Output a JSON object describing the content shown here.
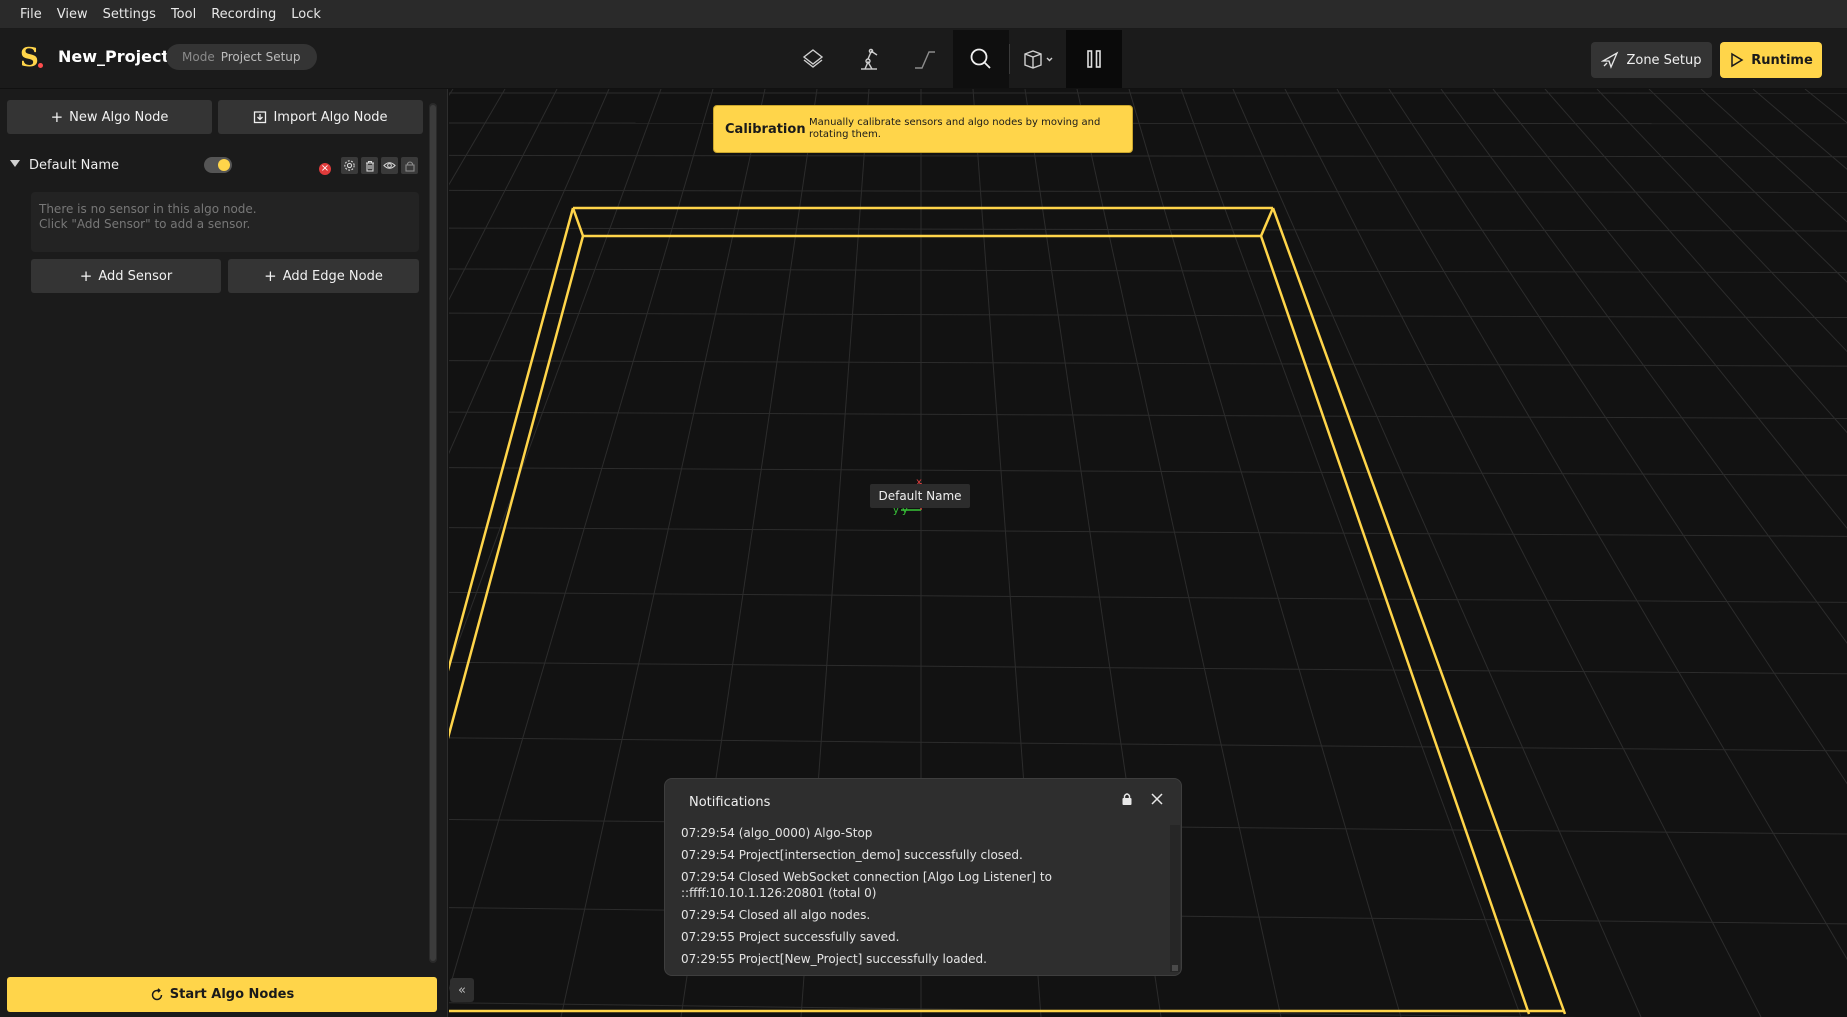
{
  "menu": [
    "File",
    "View",
    "Settings",
    "Tool",
    "Recording",
    "Lock"
  ],
  "header": {
    "logo": "S",
    "project_name": "New_Project",
    "mode_label": "Mode",
    "mode_value": "Project Setup",
    "zone_setup": "Zone Setup",
    "runtime": "Runtime"
  },
  "toolbar_icons": [
    "layers-icon",
    "robot-arm-icon",
    "slope-icon",
    "search-icon",
    "cube-view-icon",
    "pause-icon"
  ],
  "left_panel": {
    "new_algo_node": "New Algo Node",
    "import_algo_node": "Import Algo Node",
    "algo_node_name": "Default Name",
    "empty_line1": "There is no sensor in this algo node.",
    "empty_line2": "Click \"Add Sensor\" to add a sensor.",
    "add_sensor": "Add Sensor",
    "add_edge_node": "Add Edge Node",
    "start_algo_nodes": "Start Algo Nodes"
  },
  "calibration": {
    "title": "Calibration",
    "description": "Manually calibrate sensors and algo nodes by moving and rotating them."
  },
  "viewport": {
    "node_label": "Default Name",
    "axis_x": "x",
    "axis_y": "y"
  },
  "notifications": {
    "title": "Notifications",
    "lines": [
      "07:29:54 (algo_0000) Algo-Stop",
      "07:29:54 Project[intersection_demo] successfully closed.",
      "07:29:54 Closed WebSocket connection [Algo Log Listener] to ::ffff:10.10.1.126:20801 (total 0)",
      "07:29:54 Closed all algo nodes.",
      "07:29:55 Project successfully saved.",
      "07:29:55 Project[New_Project] successfully loaded."
    ]
  },
  "colors": {
    "accent": "#ffd54a",
    "background": "#121212",
    "panel": "#1b1b1b",
    "error": "#e03b3b"
  }
}
